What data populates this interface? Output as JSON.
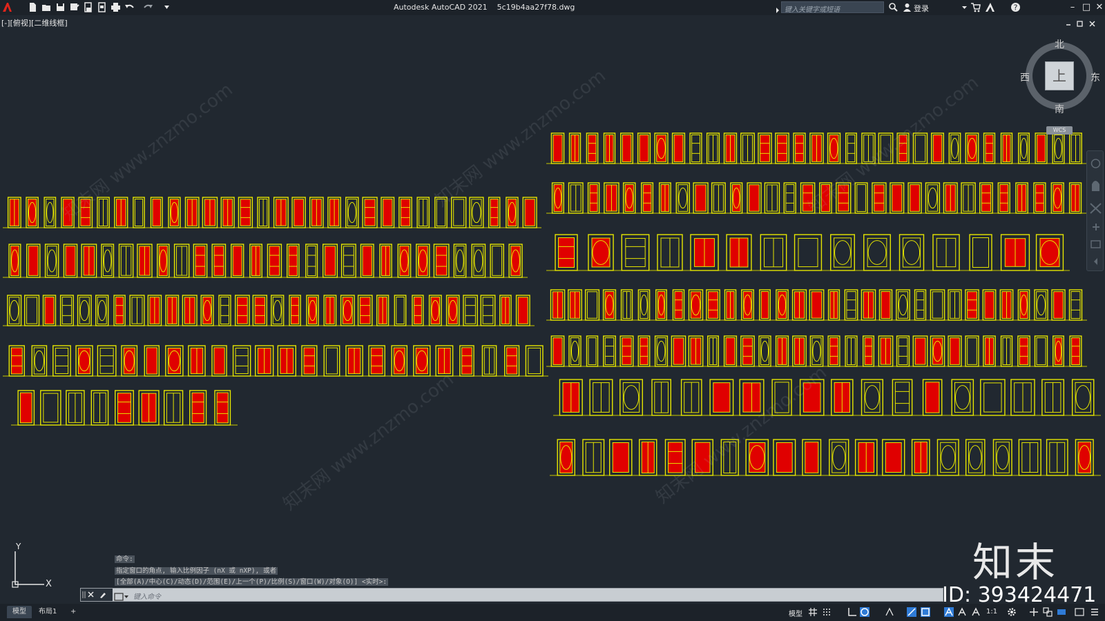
{
  "titlebar": {
    "app_title": "Autodesk AutoCAD 2021    5c19b4aa27f78.dwg",
    "search_placeholder": "键入关键字或短语",
    "login_label": "登录",
    "icons": [
      "app-menu-icon",
      "new-icon",
      "open-icon",
      "save-icon",
      "save-as-icon",
      "publish-icon",
      "plot-preview-icon",
      "print-icon",
      "undo-icon",
      "redo-icon",
      "customize-icon",
      "search-icon",
      "user-icon",
      "cart-icon",
      "autodesk-icon",
      "help-icon"
    ]
  },
  "viewport": {
    "label": "[-][俯视][二维线框]"
  },
  "viewcube": {
    "north": "北",
    "south": "南",
    "east": "东",
    "west": "西",
    "face": "上",
    "wcs": "WCS"
  },
  "colors": {
    "background": "#212830",
    "door_outline": "#e6e600",
    "door_fill": "#e00000",
    "ground_line": "#c8c800"
  },
  "watermark": {
    "text": "知末网 www.znzmo.com",
    "brand": "知末",
    "id": "ID: 393424471"
  },
  "ucs": {
    "x_label": "X",
    "y_label": "Y"
  },
  "command": {
    "history": [
      "命令:",
      "指定窗口的角点, 输入比例因子 (nX 或 nXP), 或者",
      "[全部(A)/中心(C)/动态(D)/范围(E)/上一个(P)/比例(S)/窗口(W)/对象(O)] <实时>:"
    ],
    "input_placeholder": "键入命令"
  },
  "statusbar": {
    "tabs": [
      "模型",
      "布局1",
      "+"
    ],
    "model_label": "模型",
    "scale": "1:1"
  }
}
